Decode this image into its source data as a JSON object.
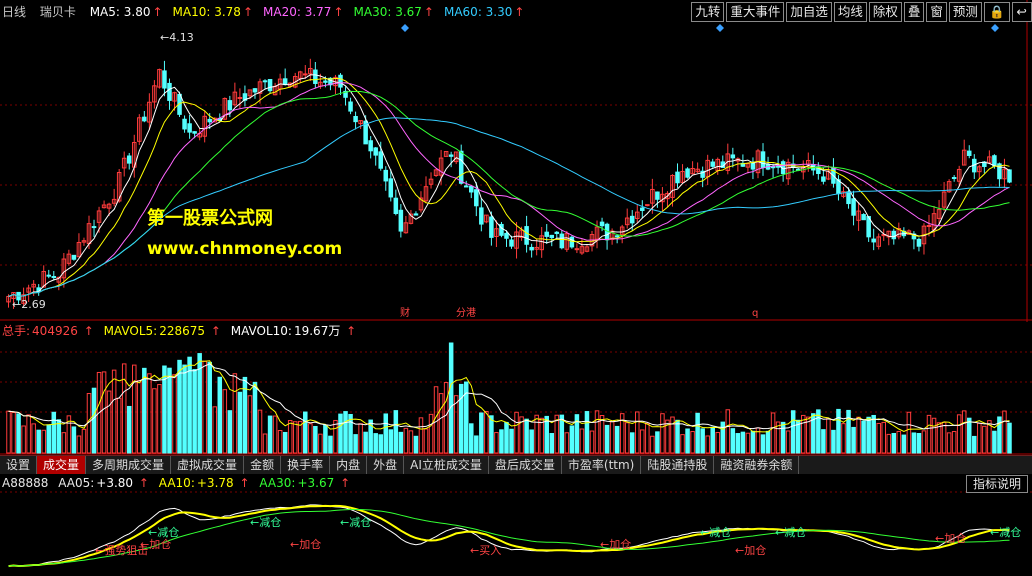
{
  "main": {
    "period": "日线",
    "name": "瑞贝卡",
    "ma": [
      {
        "label": "MA5:",
        "value": "3.80",
        "color": "#ffffff"
      },
      {
        "label": "MA10:",
        "value": "3.78",
        "color": "#ffff00"
      },
      {
        "label": "MA20:",
        "value": "3.77",
        "color": "#ff66ff"
      },
      {
        "label": "MA30:",
        "value": "3.67",
        "color": "#33ff33"
      },
      {
        "label": "MA60:",
        "value": "3.30",
        "color": "#33ccff"
      }
    ],
    "high_label": "4.13",
    "low_label": "2.69",
    "markers": [
      "财",
      "分港",
      "q"
    ]
  },
  "toolbar": [
    "九转",
    "重大事件",
    "加自选",
    "均线",
    "除权",
    "叠",
    "窗",
    "预测"
  ],
  "volume": {
    "total_label": "总手:",
    "total_value": "404926",
    "mavol5_label": "MAVOL5:",
    "mavol5_value": "228675",
    "mavol10_label": "MAVOL10:",
    "mavol10_value": "19.67万"
  },
  "tabs": [
    "设置",
    "成交量",
    "多周期成交量",
    "虚拟成交量",
    "金额",
    "换手率",
    "内盘",
    "外盘",
    "AI立桩成交量",
    "盘后成交量",
    "市盈率(ttm)",
    "陆股通持股",
    "融资融券余额"
  ],
  "active_tab": "成交量",
  "indicator": {
    "name": "A88888",
    "aa05_label": "AA05:",
    "aa05_value": "+3.80",
    "aa10_label": "AA10:",
    "aa10_value": "+3.78",
    "aa30_label": "AA30:",
    "aa30_value": "+3.67",
    "help_button": "指标说明",
    "signals": [
      "强势狙击",
      "加仓",
      "减仓",
      "减仓",
      "加仓",
      "减仓",
      "买入",
      "加仓",
      "减仓",
      "加仓",
      "减仓",
      "加仓",
      "减仓"
    ]
  },
  "watermark": {
    "line1": "第一股票公式网",
    "line2": "www.chnmoney.com"
  },
  "colors": {
    "up": "#ff3c3c",
    "down": "#54ffff",
    "grid": "#7a0000"
  }
}
